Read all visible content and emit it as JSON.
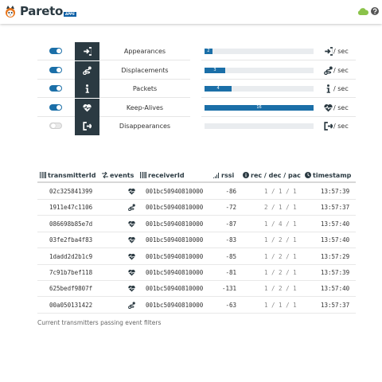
{
  "header": {
    "brand": "Pareto",
    "brand_sub": "APPS",
    "icons": [
      "pareto-logo-icon",
      "cloud-icon",
      "help-icon"
    ],
    "cloud_color": "#8bc34a"
  },
  "filters": [
    {
      "label": "Appearances",
      "enabled": true,
      "icon": "sign-in-icon",
      "rate": 2,
      "rate_pct": 7,
      "unit": "/ sec"
    },
    {
      "label": "Displacements",
      "enabled": true,
      "icon": "route-icon",
      "rate": 3,
      "rate_pct": 19,
      "unit": "/ sec"
    },
    {
      "label": "Packets",
      "enabled": true,
      "icon": "info-icon",
      "rate": 4,
      "rate_pct": 25,
      "unit": "/ sec"
    },
    {
      "label": "Keep-Alives",
      "enabled": true,
      "icon": "heartbeat-icon",
      "rate": 16,
      "rate_pct": 100,
      "unit": "/ sec"
    },
    {
      "label": "Disappearances",
      "enabled": false,
      "icon": "sign-out-icon",
      "rate": "",
      "rate_pct": 0,
      "unit": "/ sec"
    }
  ],
  "table": {
    "headers": {
      "transmitter": "transmitterId",
      "events": "events",
      "receiver": "receiverId",
      "rssi": "rssi",
      "counts": "rec / dec / pac",
      "timestamp": "timestamp"
    },
    "rows": [
      {
        "transmitter": "02c325841399",
        "event": "heartbeat-icon",
        "receiver": "001bc50940810000",
        "rssi": "-86",
        "counts": "1 / 1 / 1",
        "timestamp": "13:57:39"
      },
      {
        "transmitter": "1911e47c1106",
        "event": "route-icon",
        "receiver": "001bc50940810000",
        "rssi": "-72",
        "counts": "2 / 1 / 1",
        "timestamp": "13:57:37"
      },
      {
        "transmitter": "086698b85e7d",
        "event": "heartbeat-icon",
        "receiver": "001bc50940810000",
        "rssi": "-87",
        "counts": "1 / 4 / 1",
        "timestamp": "13:57:40"
      },
      {
        "transmitter": "03fe2fba4f83",
        "event": "heartbeat-icon",
        "receiver": "001bc50940810000",
        "rssi": "-83",
        "counts": "1 / 2 / 1",
        "timestamp": "13:57:40"
      },
      {
        "transmitter": "1dadd2d2b1c9",
        "event": "heartbeat-icon",
        "receiver": "001bc50940810000",
        "rssi": "-85",
        "counts": "1 / 2 / 1",
        "timestamp": "13:57:29"
      },
      {
        "transmitter": "7c91b7bef118",
        "event": "heartbeat-icon",
        "receiver": "001bc50940810000",
        "rssi": "-81",
        "counts": "1 / 2 / 1",
        "timestamp": "13:57:39"
      },
      {
        "transmitter": "625bedf9807f",
        "event": "heartbeat-icon",
        "receiver": "001bc50940810000",
        "rssi": "-131",
        "counts": "1 / 2 / 1",
        "timestamp": "13:57:40"
      },
      {
        "transmitter": "00a050131422",
        "event": "route-icon",
        "receiver": "001bc50940810000",
        "rssi": "-63",
        "counts": "1 / 1 / 1",
        "timestamp": "13:57:37"
      }
    ]
  },
  "caption": "Current transmitters passing event filters",
  "colors": {
    "accent": "#1b6fa8",
    "icon_bg": "#2b3a42"
  }
}
